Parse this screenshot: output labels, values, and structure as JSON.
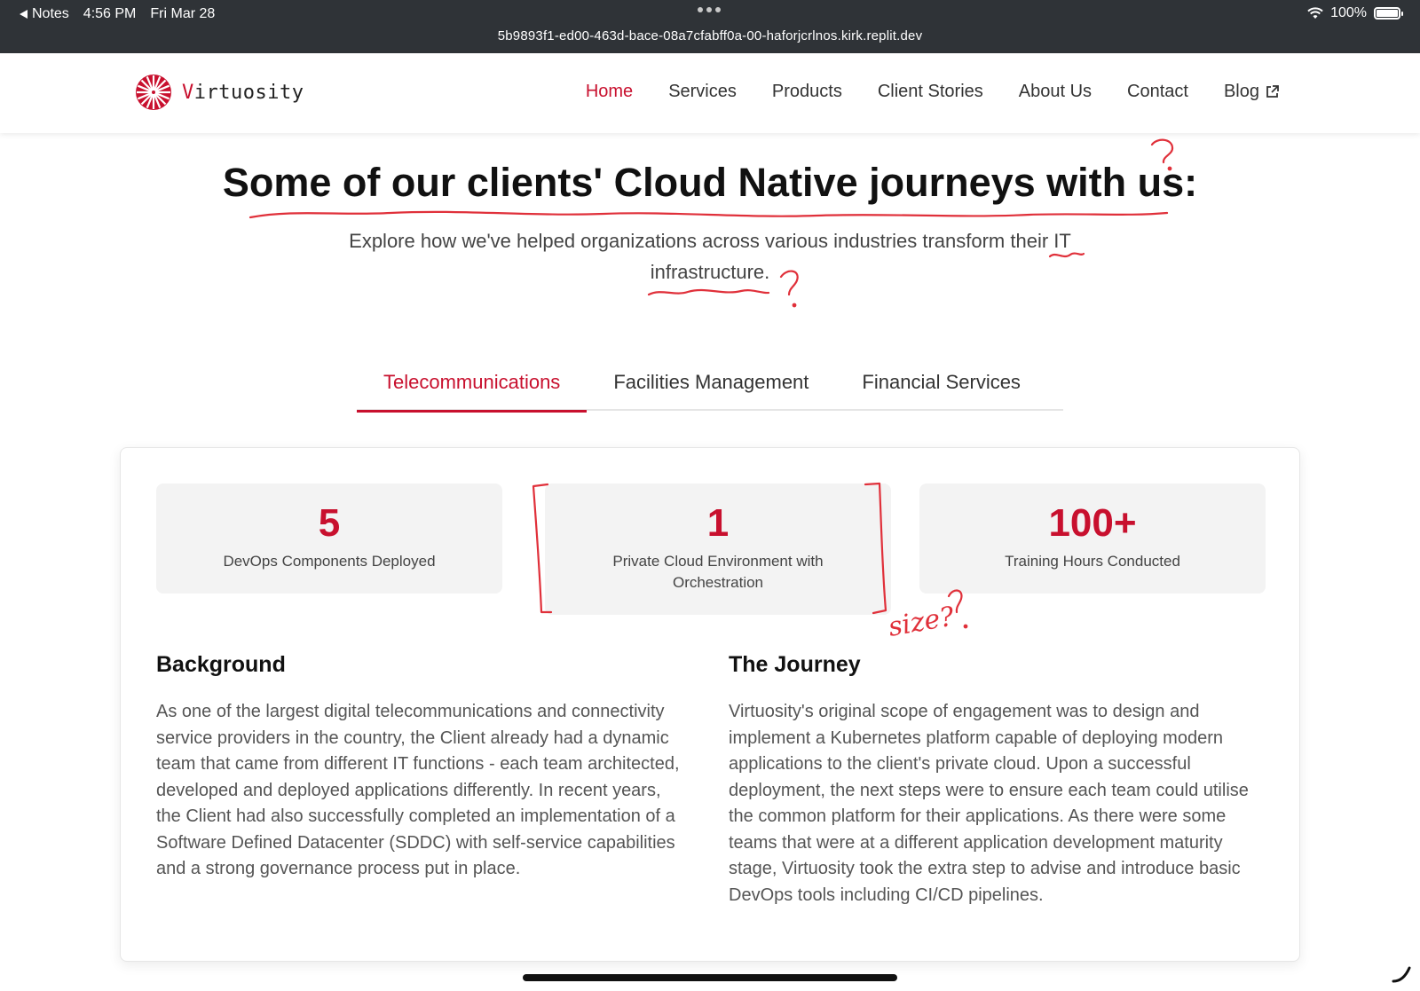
{
  "status_bar": {
    "back_label": "Notes",
    "time": "4:56 PM",
    "date": "Fri Mar 28",
    "url": "5b9893f1-ed00-463d-bace-08a7cfabff0a-00-haforjcrlnos.kirk.replit.dev",
    "battery": "100%"
  },
  "header": {
    "logo_text_first": "V",
    "logo_text_rest": "irtuosity",
    "nav": [
      "Home",
      "Services",
      "Products",
      "Client Stories",
      "About Us",
      "Contact",
      "Blog"
    ],
    "active_nav": "Home"
  },
  "hero": {
    "title": "Some of our clients' Cloud Native journeys with us:",
    "subtitle": "Explore how we've helped organizations across various industries transform their IT infrastructure."
  },
  "tabs": [
    "Telecommunications",
    "Facilities Management",
    "Financial Services"
  ],
  "active_tab": "Telecommunications",
  "stats": [
    {
      "value": "5",
      "label": "DevOps Components Deployed"
    },
    {
      "value": "1",
      "label": "Private Cloud Environment with Orchestration"
    },
    {
      "value": "100+",
      "label": "Training Hours Conducted"
    }
  ],
  "background": {
    "heading": "Background",
    "text": "As one of the largest digital telecommunications and connectivity service providers in the country, the Client already had a dynamic team that came from different IT functions - each team architected, developed and deployed applications differently. In recent years, the Client had also successfully completed an implementation of a Software Defined Datacenter (SDDC) with self-service capabilities and a strong governance process put in place."
  },
  "journey": {
    "heading": "The Journey",
    "text": "Virtuosity's original scope of engagement was to design and implement a Kubernetes platform capable of deploying modern applications to the client's private cloud. Upon a successful deployment, the next steps were to ensure each team could utilise the common platform for their applications. As there were some teams that were at a different application development maturity stage, Virtuosity took the extra step to advise and introduce basic DevOps tools including CI/CD pipelines."
  },
  "annotations": {
    "size_note": "size?",
    "accent_color": "#c8102e",
    "ink_color": "#e0303a"
  }
}
